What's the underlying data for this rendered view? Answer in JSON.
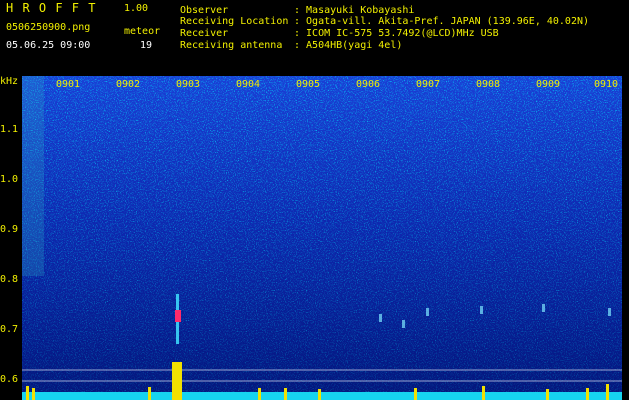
{
  "app": {
    "title": "H R O F F T",
    "version": "1.00"
  },
  "file": {
    "name": "0506250900.png",
    "datetime": "05.06.25 09:00"
  },
  "meteor": {
    "label": "meteor",
    "count": "19"
  },
  "info": {
    "labels": [
      "Observer",
      "Receiving Location",
      "Receiver",
      "Receiving antenna"
    ],
    "values": [
      ": Masayuki Kobayashi",
      ": Ogata-vill. Akita-Pref. JAPAN (139.96E, 40.02N)",
      ": ICOM IC-575 53.7492(@LCD)MHz USB",
      ": A504HB(yagi 4el)"
    ]
  },
  "colors": {
    "text": "#f2f000",
    "background": "#000000",
    "spectrum_low": "#00008c",
    "spectrum_high": "#00e0ff",
    "echo": "#ff2a6a"
  },
  "spectrogram": {
    "y_unit": "kHz",
    "y_ticks": [
      "1.1",
      "1.0",
      "0.9",
      "0.8",
      "0.7",
      "0.6"
    ],
    "x_ticks": [
      "0901",
      "0902",
      "0903",
      "0904",
      "0905",
      "0906",
      "0907",
      "0908",
      "0909",
      "0910"
    ]
  }
}
